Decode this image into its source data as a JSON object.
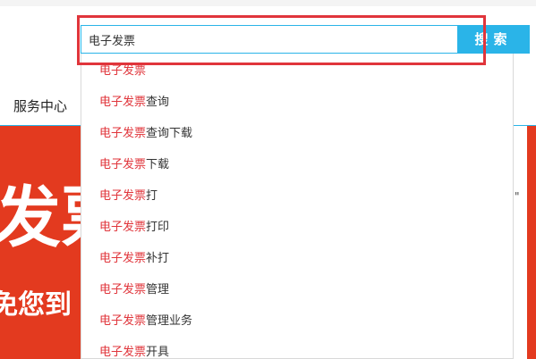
{
  "search": {
    "value": "电子发票",
    "button_label": "搜索"
  },
  "nav": {
    "service_center": "服务中心"
  },
  "banner": {
    "big_text": "发票",
    "small_text": "免您到",
    "colors": {
      "banner_red": "#e33a1f"
    }
  },
  "peek_text": "\"",
  "suggestions": {
    "keyword": "电子发票",
    "items": [
      {
        "keyword": "电子发票",
        "suffix": ""
      },
      {
        "keyword": "电子发票",
        "suffix": "查询"
      },
      {
        "keyword": "电子发票",
        "suffix": "查询下载"
      },
      {
        "keyword": "电子发票",
        "suffix": "下载"
      },
      {
        "keyword": "电子发票",
        "suffix": "打"
      },
      {
        "keyword": "电子发票",
        "suffix": "打印"
      },
      {
        "keyword": "电子发票",
        "suffix": "补打"
      },
      {
        "keyword": "电子发票",
        "suffix": "管理"
      },
      {
        "keyword": "电子发票",
        "suffix": "管理业务"
      },
      {
        "keyword": "电子发票",
        "suffix": "开具"
      }
    ]
  },
  "colors": {
    "accent": "#2ab4e8",
    "highlight_red": "#e0353b",
    "text": "#333333"
  }
}
